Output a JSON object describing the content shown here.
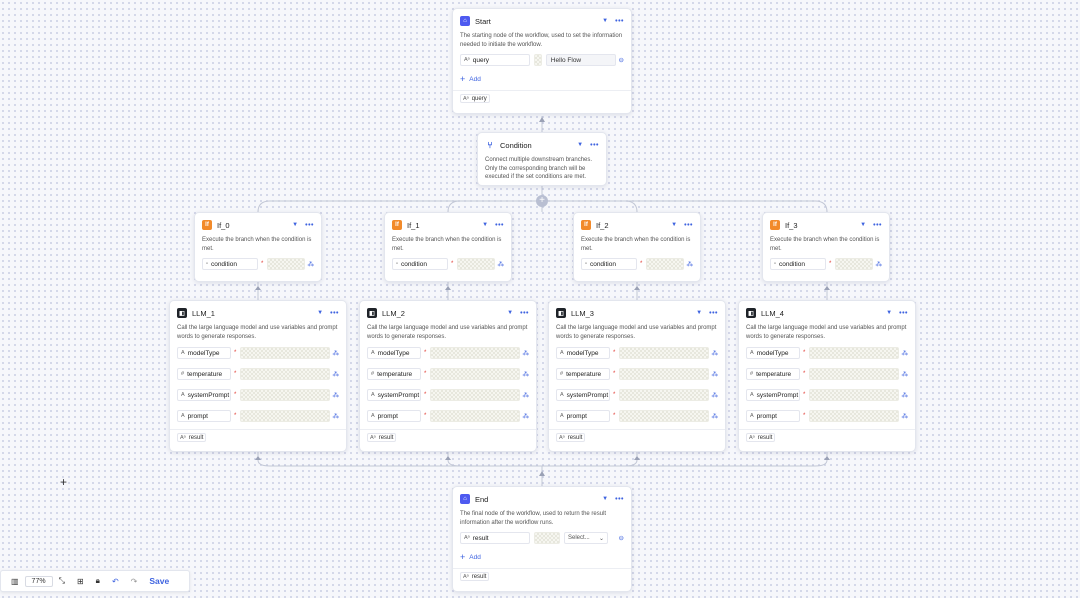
{
  "start": {
    "title": "Start",
    "description": "The starting node of the workflow, used to set the information needed to initiate the workflow.",
    "variable": "query",
    "value": "Hello Flow",
    "add_label": "Add",
    "output": "query"
  },
  "condition": {
    "title": "Condition",
    "description": "Connect multiple downstream branches. Only the corresponding branch will be executed if the set conditions are met.",
    "add_symbol": "+"
  },
  "ifs": [
    {
      "title": "If_0",
      "description": "Execute the branch when the condition is met.",
      "field": "condition"
    },
    {
      "title": "If_1",
      "description": "Execute the branch when the condition is met.",
      "field": "condition"
    },
    {
      "title": "If_2",
      "description": "Execute the branch when the condition is met.",
      "field": "condition"
    },
    {
      "title": "If_3",
      "description": "Execute the branch when the condition is met.",
      "field": "condition"
    }
  ],
  "llms": [
    {
      "title": "LLM_1",
      "description": "Call the large language model and use variables and prompt words to generate responses.",
      "fields": [
        "modelType",
        "temperature",
        "systemPrompt",
        "prompt"
      ],
      "output": "result"
    },
    {
      "title": "LLM_2",
      "description": "Call the large language model and use variables and prompt words to generate responses.",
      "fields": [
        "modelType",
        "temperature",
        "systemPrompt",
        "prompt"
      ],
      "output": "result"
    },
    {
      "title": "LLM_3",
      "description": "Call the large language model and use variables and prompt words to generate responses.",
      "fields": [
        "modelType",
        "temperature",
        "systemPrompt",
        "prompt"
      ],
      "output": "result"
    },
    {
      "title": "LLM_4",
      "description": "Call the large language model and use variables and prompt words to generate responses.",
      "fields": [
        "modelType",
        "temperature",
        "systemPrompt",
        "prompt"
      ],
      "output": "result"
    }
  ],
  "end": {
    "title": "End",
    "description": "The final node of the workflow, used to return the result information after the workflow runs.",
    "variable": "result",
    "select_placeholder": "Select...",
    "add_label": "Add",
    "output": "result"
  },
  "toolbar": {
    "zoom": "77%",
    "save_label": "Save"
  },
  "colors": {
    "accent": "#3e63e0",
    "start_end_icon": "#4e5af0",
    "if_icon": "#f28a2a",
    "llm_icon": "#1f2329",
    "required": "#e0322b"
  }
}
